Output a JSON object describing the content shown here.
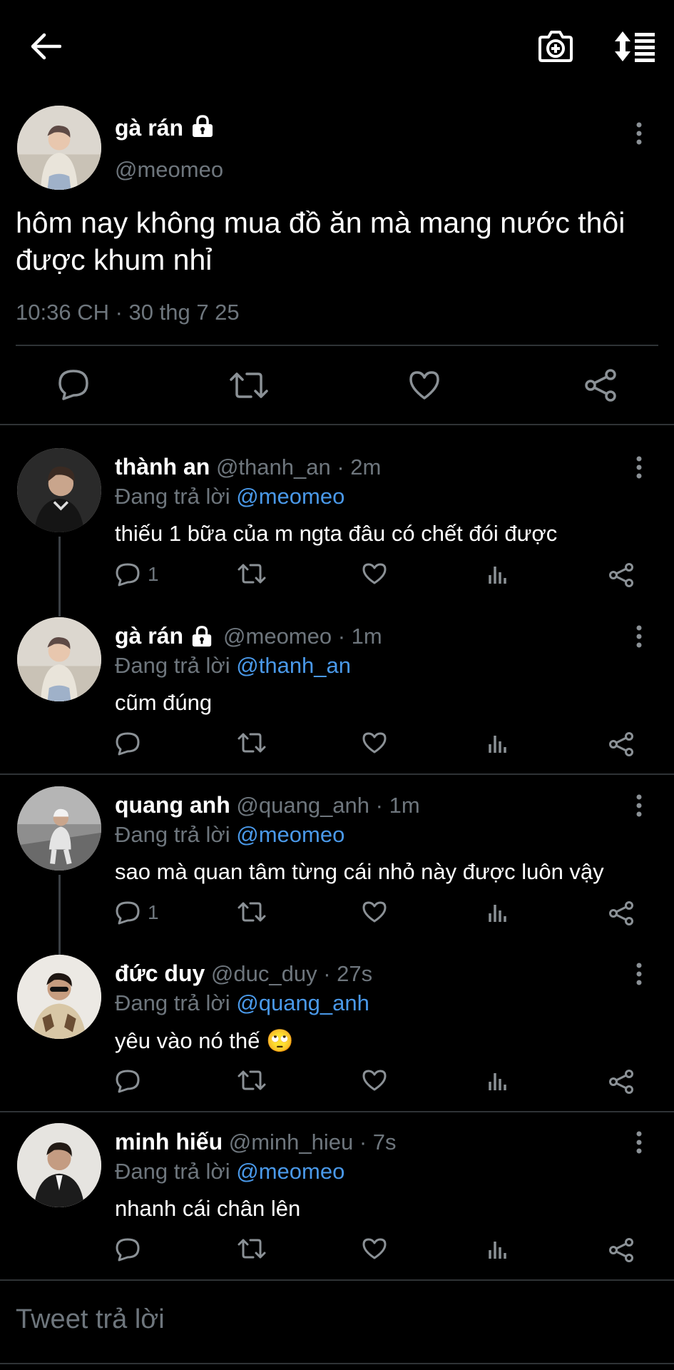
{
  "topbar": {
    "back_icon": "arrow-left-icon",
    "camera_icon": "camera-add-icon",
    "sort_icon": "sort-list-icon"
  },
  "main_tweet": {
    "name": "gà rán",
    "handle": "@meomeo",
    "text_line1": "hôm nay không mua đồ ăn mà mang nước thôi",
    "text_line2": "được khum nhỉ",
    "timestamp": "10:36 CH · 30 thg 7 25"
  },
  "replies": [
    {
      "name": "thành an",
      "meta": "@thanh_an · 2m",
      "replying_prefix": "Đang trả lời",
      "replying_to": "@meomeo",
      "text": "thiếu 1 bữa của m ngta đâu có chết đói được",
      "reply_count": "1"
    },
    {
      "name": "gà rán",
      "meta": "@meomeo · 1m",
      "replying_prefix": "Đang trả lời",
      "replying_to": "@thanh_an",
      "text": "cũm đúng",
      "reply_count": ""
    },
    {
      "name": "quang anh",
      "meta": "@quang_anh · 1m",
      "replying_prefix": "Đang trả lời",
      "replying_to": "@meomeo",
      "text": "sao mà quan tâm từng cái nhỏ này được luôn vậy",
      "reply_count": "1"
    },
    {
      "name": "đức duy",
      "meta": "@duc_duy · 27s",
      "replying_prefix": "Đang trả lời",
      "replying_to": "@quang_anh",
      "text": "yêu vào nó thế 🙄",
      "reply_count": ""
    },
    {
      "name": "minh hiếu",
      "meta": "@minh_hieu · 7s",
      "replying_prefix": "Đang trả lời",
      "replying_to": "@meomeo",
      "text": "nhanh cái chân lên",
      "reply_count": ""
    }
  ],
  "compose": {
    "placeholder": "Tweet trả lời"
  },
  "colors": {
    "background": "#000000",
    "link": "#4a99e9",
    "muted": "#6e767d",
    "divider": "#2f3336"
  }
}
